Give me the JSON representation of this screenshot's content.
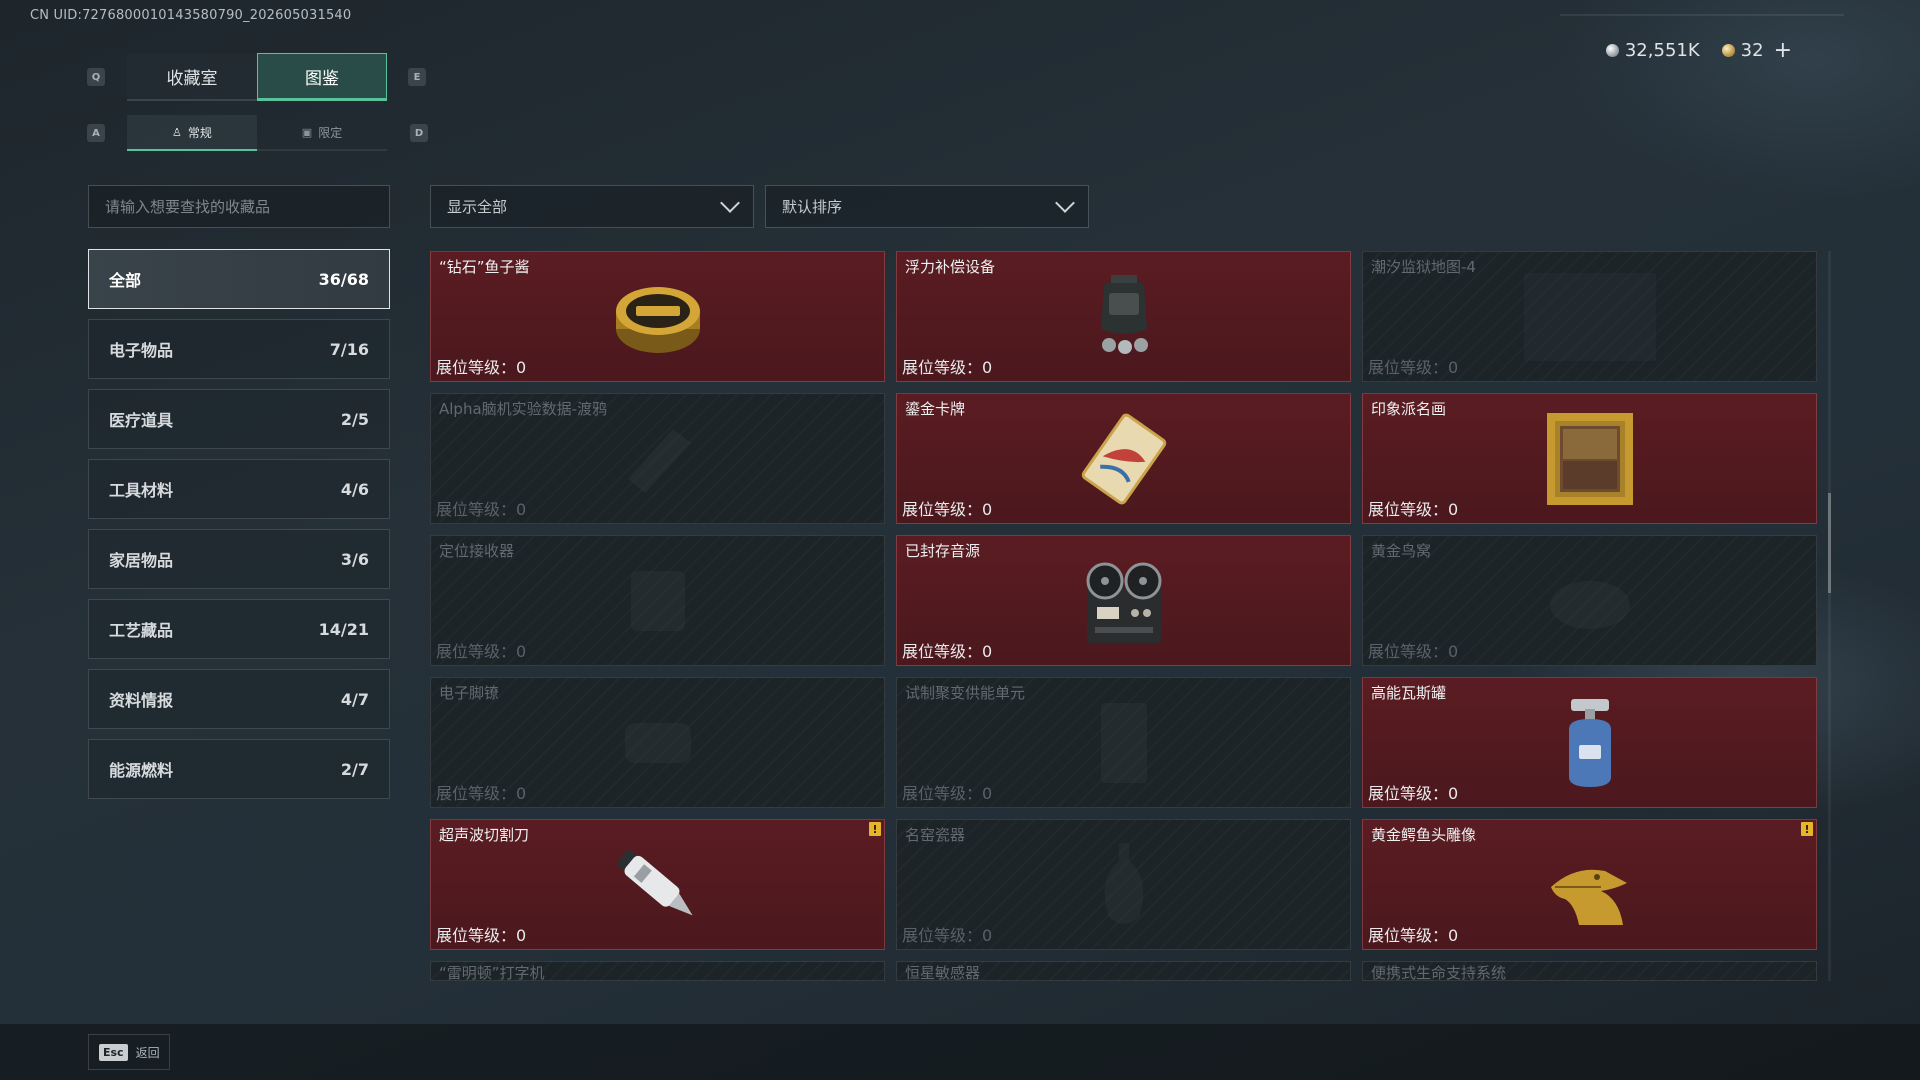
{
  "uid": "CN UID:7276800010143580790_202605031540",
  "currency": {
    "silver": "32,551K",
    "gold": "32",
    "plus": "+"
  },
  "keys": {
    "q": "Q",
    "e": "E",
    "a": "A",
    "d": "D"
  },
  "tabs": [
    {
      "label": "收藏室",
      "active": false
    },
    {
      "label": "图鉴",
      "active": true
    }
  ],
  "subtabs": [
    {
      "label": "常规",
      "icon": "person-icon",
      "active": true
    },
    {
      "label": "限定",
      "icon": "image-icon",
      "active": false
    }
  ],
  "search": {
    "placeholder": "请输入想要查找的收藏品"
  },
  "filter": {
    "selected": "显示全部"
  },
  "sort": {
    "selected": "默认排序"
  },
  "categories": [
    {
      "label": "全部",
      "count": "36/68",
      "active": true
    },
    {
      "label": "电子物品",
      "count": "7/16"
    },
    {
      "label": "医疗道具",
      "count": "2/5"
    },
    {
      "label": "工具材料",
      "count": "4/6"
    },
    {
      "label": "家居物品",
      "count": "3/6"
    },
    {
      "label": "工艺藏品",
      "count": "14/21"
    },
    {
      "label": "资料情报",
      "count": "4/7"
    },
    {
      "label": "能源燃料",
      "count": "2/7"
    }
  ],
  "level_label": "展位等级：",
  "items": [
    {
      "name": "“钻石”鱼子酱",
      "level": "0",
      "owned": true,
      "icon": "caviar-tin-icon"
    },
    {
      "name": "浮力补偿设备",
      "level": "0",
      "owned": true,
      "icon": "buoyancy-device-icon"
    },
    {
      "name": "潮汐监狱地图-4",
      "level": "0",
      "owned": false,
      "icon": "map-icon"
    },
    {
      "name": "Alpha脑机实验数据-渡鸦",
      "level": "0",
      "owned": false,
      "icon": "data-drive-icon"
    },
    {
      "name": "鎏金卡牌",
      "level": "0",
      "owned": true,
      "icon": "gilded-card-icon"
    },
    {
      "name": "印象派名画",
      "level": "0",
      "owned": true,
      "icon": "framed-painting-icon"
    },
    {
      "name": "定位接收器",
      "level": "0",
      "owned": false,
      "icon": "receiver-icon"
    },
    {
      "name": "已封存音源",
      "level": "0",
      "owned": true,
      "icon": "reel-recorder-icon"
    },
    {
      "name": "黄金鸟窝",
      "level": "0",
      "owned": false,
      "icon": "bird-nest-icon"
    },
    {
      "name": "电子脚镣",
      "level": "0",
      "owned": false,
      "icon": "ankle-monitor-icon"
    },
    {
      "name": "试制聚变供能单元",
      "level": "0",
      "owned": false,
      "icon": "fusion-cell-icon"
    },
    {
      "name": "高能瓦斯罐",
      "level": "0",
      "owned": true,
      "icon": "gas-canister-icon"
    },
    {
      "name": "超声波切割刀",
      "level": "0",
      "owned": true,
      "icon": "ultrasonic-knife-icon",
      "alert": true
    },
    {
      "name": "名窑瓷器",
      "level": "0",
      "owned": false,
      "icon": "porcelain-vase-icon"
    },
    {
      "name": "黄金鳄鱼头雕像",
      "level": "0",
      "owned": true,
      "icon": "gold-crocodile-icon",
      "alert": true
    },
    {
      "name": "“雷明顿”打字机",
      "owned": false,
      "partial": true
    },
    {
      "name": "恒星敏感器",
      "owned": false,
      "partial": true
    },
    {
      "name": "便携式生命支持系统",
      "owned": false,
      "partial": true
    }
  ],
  "alert_mark": "!",
  "footer": {
    "esc_key": "Esc",
    "back_label": "返回"
  }
}
